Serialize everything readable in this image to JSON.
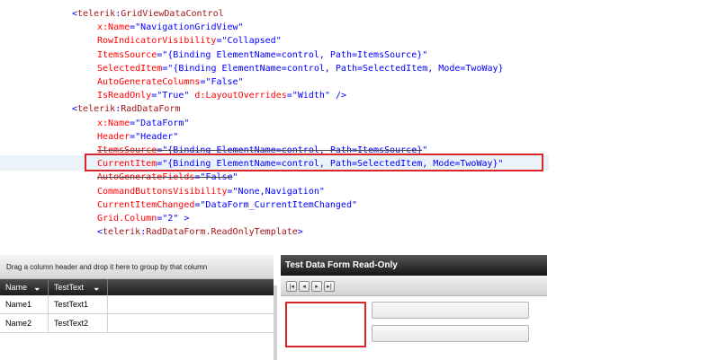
{
  "code_lines": [
    {
      "indent": 80,
      "segs": [
        {
          "t": "<",
          "c": "pun"
        },
        {
          "t": "telerik",
          "c": "tag"
        },
        {
          "t": ":",
          "c": "pun"
        },
        {
          "t": "GridViewDataControl",
          "c": "tag"
        }
      ]
    },
    {
      "indent": 108,
      "segs": [
        {
          "t": "x:Name",
          "c": "attr"
        },
        {
          "t": "=\"",
          "c": "pun"
        },
        {
          "t": "NavigationGridView",
          "c": "val"
        },
        {
          "t": "\"",
          "c": "pun"
        }
      ]
    },
    {
      "indent": 108,
      "segs": [
        {
          "t": "RowIndicatorVisibility",
          "c": "attr"
        },
        {
          "t": "=\"",
          "c": "pun"
        },
        {
          "t": "Collapsed",
          "c": "val"
        },
        {
          "t": "\"",
          "c": "pun"
        }
      ]
    },
    {
      "indent": 108,
      "segs": [
        {
          "t": "ItemsSource",
          "c": "attr"
        },
        {
          "t": "=\"",
          "c": "pun"
        },
        {
          "t": "{Binding ElementName=control, Path=ItemsSource}",
          "c": "val"
        },
        {
          "t": "\"",
          "c": "pun"
        }
      ]
    },
    {
      "indent": 108,
      "segs": [
        {
          "t": "SelectedItem",
          "c": "attr"
        },
        {
          "t": "=\"",
          "c": "pun"
        },
        {
          "t": "{Binding ElementName=control, Path=SelectedItem, Mode=TwoWay}",
          "c": "val"
        }
      ]
    },
    {
      "indent": 108,
      "segs": [
        {
          "t": "AutoGenerateColumns",
          "c": "attr"
        },
        {
          "t": "=\"",
          "c": "pun"
        },
        {
          "t": "False",
          "c": "val"
        },
        {
          "t": "\"",
          "c": "pun"
        }
      ]
    },
    {
      "indent": 108,
      "segs": [
        {
          "t": "IsReadOnly",
          "c": "attr"
        },
        {
          "t": "=\"",
          "c": "pun"
        },
        {
          "t": "True",
          "c": "val"
        },
        {
          "t": "\" ",
          "c": "pun"
        },
        {
          "t": "d:LayoutOverrides",
          "c": "attr"
        },
        {
          "t": "=\"",
          "c": "pun"
        },
        {
          "t": "Width",
          "c": "val"
        },
        {
          "t": "\" />",
          "c": "pun"
        }
      ]
    },
    {
      "indent": 80,
      "segs": [
        {
          "t": "<",
          "c": "pun"
        },
        {
          "t": "telerik",
          "c": "tag"
        },
        {
          "t": ":",
          "c": "pun"
        },
        {
          "t": "RadDataForm",
          "c": "tag"
        }
      ]
    },
    {
      "indent": 108,
      "segs": [
        {
          "t": "x:Name",
          "c": "attr"
        },
        {
          "t": "=\"",
          "c": "pun"
        },
        {
          "t": "DataForm",
          "c": "val"
        },
        {
          "t": "\"",
          "c": "pun"
        }
      ]
    },
    {
      "indent": 108,
      "segs": [
        {
          "t": "Header",
          "c": "attr"
        },
        {
          "t": "=\"",
          "c": "pun"
        },
        {
          "t": "Header",
          "c": "val"
        },
        {
          "t": "\"",
          "c": "pun"
        }
      ]
    },
    {
      "indent": 108,
      "segs": [
        {
          "t": "ItemsSource",
          "c": "attr strike"
        },
        {
          "t": "=\"",
          "c": "pun strike"
        },
        {
          "t": "{Binding ElementName=control, Path=ItemsSource}",
          "c": "val strike"
        },
        {
          "t": "\"",
          "c": "pun"
        }
      ]
    },
    {
      "indent": 108,
      "segs": [
        {
          "t": "CurrentItem",
          "c": "attr"
        },
        {
          "t": "=\"",
          "c": "pun"
        },
        {
          "t": "{Binding ElementName=control, Path=SelectedItem, Mode=TwoWay}",
          "c": "val"
        },
        {
          "t": "\"",
          "c": "pun"
        }
      ]
    },
    {
      "indent": 108,
      "segs": [
        {
          "t": "AutoGenerateFields",
          "c": "attr strike"
        },
        {
          "t": "=\"",
          "c": "pun strike"
        },
        {
          "t": "False",
          "c": "val strike"
        },
        {
          "t": "\"",
          "c": "pun"
        }
      ]
    },
    {
      "indent": 108,
      "segs": [
        {
          "t": "CommandButtonsVisibility",
          "c": "attr"
        },
        {
          "t": "=\"",
          "c": "pun"
        },
        {
          "t": "None,Navigation",
          "c": "val"
        },
        {
          "t": "\"",
          "c": "pun"
        }
      ]
    },
    {
      "indent": 108,
      "segs": [
        {
          "t": "CurrentItemChanged",
          "c": "attr"
        },
        {
          "t": "=\"",
          "c": "pun"
        },
        {
          "t": "DataForm_CurrentItemChanged",
          "c": "val"
        },
        {
          "t": "\"",
          "c": "pun"
        }
      ]
    },
    {
      "indent": 108,
      "segs": [
        {
          "t": "Grid.Column",
          "c": "attr"
        },
        {
          "t": "=\"",
          "c": "pun"
        },
        {
          "t": "2",
          "c": "val"
        },
        {
          "t": "\" >",
          "c": "pun"
        }
      ]
    },
    {
      "indent": 108,
      "segs": [
        {
          "t": "<",
          "c": "pun"
        },
        {
          "t": "telerik",
          "c": "tag"
        },
        {
          "t": ":",
          "c": "pun"
        },
        {
          "t": "RadDataForm.ReadOnlyTemplate",
          "c": "tag"
        },
        {
          "t": ">",
          "c": "pun"
        }
      ]
    }
  ],
  "grid": {
    "group_panel_text": "Drag a column header and drop it here to group by that column",
    "columns": [
      "Name",
      "TestText"
    ],
    "filter_icon": "filter-icon",
    "rows": [
      [
        "Name1",
        "TestText1"
      ],
      [
        "Name2",
        "TestText2"
      ]
    ]
  },
  "form": {
    "header": "Test Data Form Read-Only",
    "nav_buttons": [
      {
        "icon": "first-icon",
        "glyph": "|◂"
      },
      {
        "icon": "previous-icon",
        "glyph": "◂"
      },
      {
        "icon": "next-icon",
        "glyph": "▸"
      },
      {
        "icon": "last-icon",
        "glyph": "▸|"
      }
    ]
  },
  "colors": {
    "highlight_border": "#d8262a",
    "xaml_tag": "#a31515",
    "xaml_attribute": "#ff0000",
    "xaml_value": "#0000ff"
  }
}
